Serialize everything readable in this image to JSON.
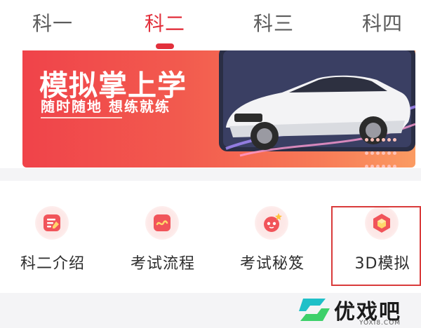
{
  "tabs": [
    {
      "label": "科一",
      "active": false
    },
    {
      "label": "科二",
      "active": true
    },
    {
      "label": "科三",
      "active": false
    },
    {
      "label": "科四",
      "active": false
    }
  ],
  "banner": {
    "title": "模拟掌上学",
    "subtitle": "随时随地  想练就练"
  },
  "features": [
    {
      "label": "科二介绍",
      "icon": "intro-icon"
    },
    {
      "label": "考试流程",
      "icon": "process-icon"
    },
    {
      "label": "考试秘笈",
      "icon": "tips-icon"
    },
    {
      "label": "3D模拟",
      "icon": "3d-cube-icon",
      "highlighted": true
    }
  ],
  "watermark": {
    "text": "优戏吧",
    "url": "YOXI8.COM"
  },
  "colors": {
    "accent": "#e2303c",
    "banner_start": "#f0434a",
    "banner_end": "#fb9b62",
    "highlight_border": "#d93a3a"
  }
}
